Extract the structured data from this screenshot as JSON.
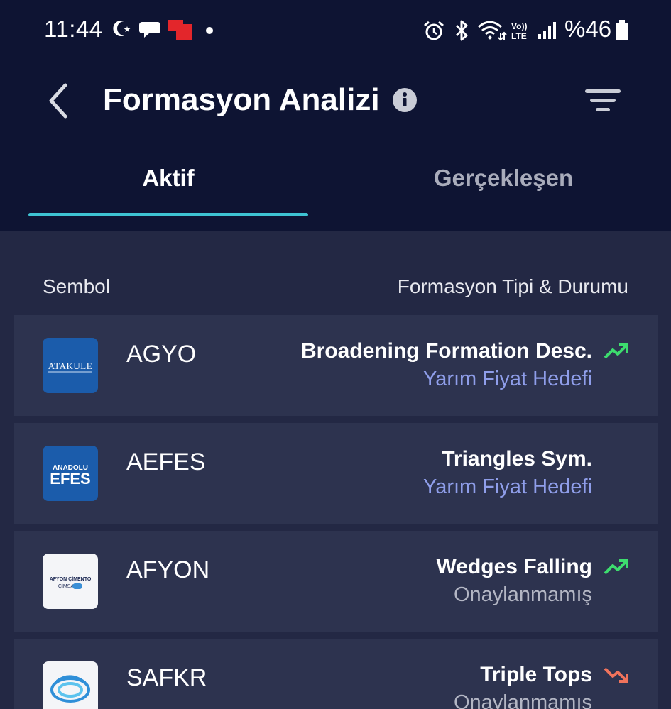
{
  "status_bar": {
    "time": "11:44",
    "battery": "%46"
  },
  "header": {
    "title": "Formasyon Analizi"
  },
  "tabs": [
    {
      "label": "Aktif"
    },
    {
      "label": "Gerçekleşen"
    }
  ],
  "list_header": {
    "left": "Sembol",
    "right": "Formasyon Tipi & Durumu"
  },
  "rows": [
    {
      "symbol": "AGYO",
      "formation": "Broadening Formation Desc.",
      "status": "Yarım Fiyat Hedefi",
      "status_color": "#8f9eea",
      "trend": "up",
      "logo_text": "ATAKULE"
    },
    {
      "symbol": "AEFES",
      "formation": "Triangles Sym.",
      "status": "Yarım Fiyat Hedefi",
      "status_color": "#8f9eea",
      "trend": "none",
      "logo_text": "ANADOLU EFES"
    },
    {
      "symbol": "AFYON",
      "formation": "Wedges Falling",
      "status": "Onaylanmamış",
      "status_color": "#b3b6c4",
      "trend": "up",
      "logo_text": "AFYON ÇİMENTO"
    },
    {
      "symbol": "SAFKR",
      "formation": "Triple Tops",
      "status": "Onaylanmamış",
      "status_color": "#b3b6c4",
      "trend": "down",
      "logo_text": ""
    }
  ],
  "colors": {
    "accent": "#3ec3d3",
    "trend_up": "#3ddc6e",
    "trend_down": "#f0735c"
  }
}
